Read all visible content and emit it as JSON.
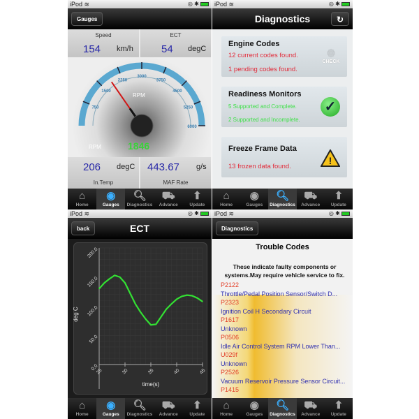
{
  "status": {
    "carrier": "iPod"
  },
  "tabs": [
    "Home",
    "Gauges",
    "Diagnostics",
    "Advance",
    "Update"
  ],
  "tab_icons": [
    "home-icon",
    "gauge-icon",
    "magnifier-icon",
    "car-icon",
    "arrow-up-icon"
  ],
  "gauges": {
    "nav_button": "Gauges",
    "active_tab": "Gauges",
    "speed": {
      "label": "Speed",
      "value": "154",
      "unit": "km/h"
    },
    "ect": {
      "label": "ECT",
      "value": "54",
      "unit": "degC"
    },
    "rpm": {
      "label": "RPM",
      "dial_label": "RPM",
      "value": "1846",
      "max": 6000,
      "ticks": [
        "750",
        "1500",
        "2250",
        "3000",
        "3750",
        "4500",
        "5250",
        "6000"
      ]
    },
    "intemp": {
      "label": "In.Temp",
      "value": "206",
      "unit": "degC"
    },
    "maf": {
      "label": "MAF Rate",
      "value": "443.67",
      "unit": "g/s"
    }
  },
  "diagnostics": {
    "title": "Diagnostics",
    "active_tab": "Diagnostics",
    "refresh_icon": "refresh-icon",
    "engine": {
      "title": "Engine Codes",
      "line1": "12 current codes found.",
      "line2": "1 pending codes found.",
      "icon_text": "CHECK"
    },
    "readiness": {
      "title": "Readiness Monitors",
      "line1": "5 Supported and Complete.",
      "line2": "2 Supported and Incomplete."
    },
    "freeze": {
      "title": "Freeze Frame Data",
      "line1": "13 frozen data found."
    },
    "colors": {
      "red": "#e22b3a",
      "green": "#3ee048"
    }
  },
  "ect_chart": {
    "title": "ECT",
    "back": "back",
    "active_tab": "Gauges",
    "chart_data": {
      "type": "line",
      "xlabel": "time(s)",
      "ylabel": "deg C",
      "xlim": [
        25,
        45
      ],
      "ylim": [
        0,
        200
      ],
      "xticks": [
        "25",
        "30",
        "35",
        "40",
        "45"
      ],
      "yticks": [
        "0.0",
        "50.0",
        "100.0",
        "150.0",
        "200.0"
      ],
      "grid": true,
      "line_color": "#33e033",
      "x": [
        25,
        26,
        27,
        28,
        29,
        30,
        31,
        32,
        33,
        34,
        35,
        36,
        37,
        38,
        39,
        40,
        41,
        42,
        43,
        44,
        45
      ],
      "y": [
        130,
        140,
        147,
        153,
        150,
        140,
        122,
        104,
        90,
        78,
        68,
        69,
        82,
        95,
        104,
        112,
        117,
        119,
        118,
        114,
        108
      ]
    }
  },
  "trouble": {
    "nav_button": "Diagnostics",
    "active_tab": "Diagnostics",
    "title": "Trouble Codes",
    "intro": "These indicate faulty components or systems.May require vehicle service to fix.",
    "codes": [
      {
        "code": "P2122",
        "desc": "Throttle/Pedal Position Sensor/Switch D..."
      },
      {
        "code": "P2323",
        "desc": "Ignition Coil H Secondary Circuit"
      },
      {
        "code": "P1617",
        "desc": "Unknown"
      },
      {
        "code": "P0506",
        "desc": "Idle Air Control System RPM Lower Than..."
      },
      {
        "code": "U029f",
        "desc": "Unknown"
      },
      {
        "code": "P2526",
        "desc": "Vacuum Reservoir Pressure Sensor Circuit..."
      },
      {
        "code": "P1415",
        "desc": ""
      }
    ]
  }
}
